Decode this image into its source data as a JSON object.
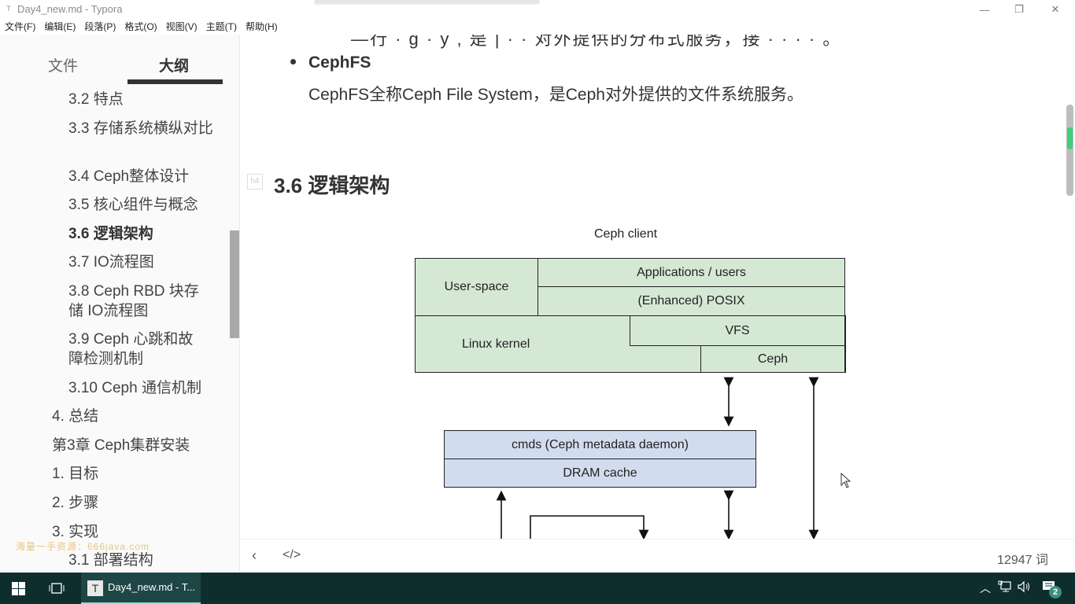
{
  "window": {
    "title": "Day4_new.md - Typora",
    "app_icon": "T",
    "minimize_icon": "—",
    "maximize_icon": "❐",
    "close_icon": "✕"
  },
  "menu": [
    {
      "label": "文件(F)"
    },
    {
      "label": "编辑(E)"
    },
    {
      "label": "段落(P)"
    },
    {
      "label": "格式(O)"
    },
    {
      "label": "视图(V)"
    },
    {
      "label": "主题(T)"
    },
    {
      "label": "帮助(H)"
    }
  ],
  "sidebar": {
    "tabs": [
      {
        "label": "文件",
        "active": false
      },
      {
        "label": "大纲",
        "active": true
      }
    ],
    "outline": [
      {
        "label": "3.2 特点",
        "level": 2,
        "active": false
      },
      {
        "label": "3.3 存储系统横纵对比",
        "level": 2,
        "active": false
      },
      {
        "label": "3.4 Ceph整体设计",
        "level": 2,
        "active": false
      },
      {
        "label": "3.5 核心组件与概念",
        "level": 2,
        "active": false
      },
      {
        "label": "3.6 逻辑架构",
        "level": 2,
        "active": true
      },
      {
        "label": "3.7 IO流程图",
        "level": 2,
        "active": false
      },
      {
        "label": "3.8 Ceph RBD 块存储 IO流程图",
        "level": 2,
        "active": false
      },
      {
        "label": "3.9 Ceph 心跳和故障检测机制",
        "level": 2,
        "active": false
      },
      {
        "label": "3.10 Ceph 通信机制",
        "level": 2,
        "active": false
      },
      {
        "label": "4. 总结",
        "level": 1,
        "active": false
      },
      {
        "label": "第3章 Ceph集群安装",
        "level": 1,
        "active": false
      },
      {
        "label": "1. 目标",
        "level": 1,
        "active": false
      },
      {
        "label": "2. 步骤",
        "level": 1,
        "active": false
      },
      {
        "label": "3. 实现",
        "level": 1,
        "active": false
      },
      {
        "label": "3.1 部署结构",
        "level": 2,
        "active": false
      }
    ],
    "watermark": "海量一手资源：666java.com"
  },
  "editor": {
    "cut_line": "—行  ·  g   ·  y  ,  是 |  · ·  对外提供的分布式服务，接  ·  ·  ·  ·  。",
    "bullet": {
      "title": "CephFS",
      "desc": "CephFS全称Ceph File System，是Ceph对外提供的文件系统服务。"
    },
    "heading_marker": "h4",
    "heading": "3.6  逻辑架构",
    "diagram": {
      "title": "Ceph client",
      "boxes": {
        "user_space": "User-space",
        "applications": "Applications / users",
        "posix": "(Enhanced) POSIX",
        "linux_kernel": "Linux kernel",
        "vfs": "VFS",
        "ceph": "Ceph",
        "cmds": "cmds (Ceph metadata daemon)",
        "dram": "DRAM cache"
      },
      "colors": {
        "client": "#d5e8d4",
        "mds": "#d2dcef"
      }
    }
  },
  "footer": {
    "back_icon": "‹",
    "source_icon": "</>",
    "word_count": "12947 词"
  },
  "taskbar": {
    "app_label": "Day4_new.md - T...",
    "app_icon": "T",
    "notification_count": "2"
  }
}
